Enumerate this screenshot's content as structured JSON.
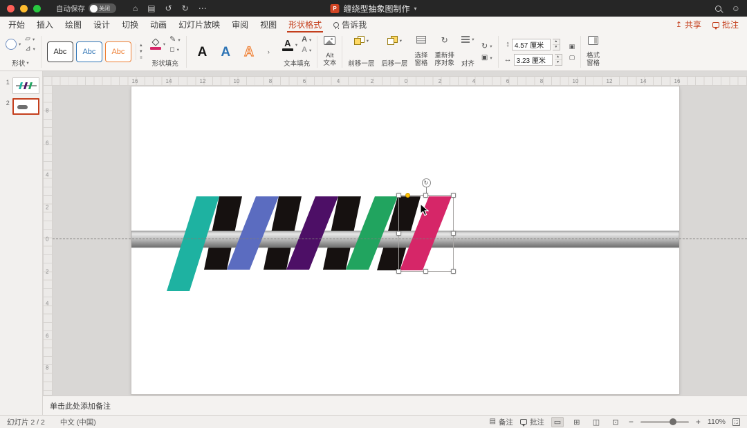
{
  "titlebar": {
    "autosave_label": "自动保存",
    "autosave_state": "关闭",
    "doc_title": "缠绕型抽象图制作"
  },
  "tabs": {
    "active": "形状格式",
    "items": [
      {
        "label": "开始"
      },
      {
        "label": "插入"
      },
      {
        "label": "绘图"
      },
      {
        "label": "设计"
      },
      {
        "label": "切换"
      },
      {
        "label": "动画"
      },
      {
        "label": "幻灯片放映"
      },
      {
        "label": "审阅"
      },
      {
        "label": "视图"
      },
      {
        "label": "形状格式"
      },
      {
        "label": "告诉我",
        "icon": "bulb"
      }
    ]
  },
  "quick_actions": {
    "share": "共享",
    "comments": "批注"
  },
  "ribbon": {
    "shapes_label": "形状",
    "style_samples": [
      "Abc",
      "Abc",
      "Abc"
    ],
    "wordart_samples": [
      "A",
      "A",
      "A"
    ],
    "shape_fill_label": "形状填充",
    "text_fill_label": "文本填充",
    "alt_text_label": [
      "Alt",
      "文本"
    ],
    "bring_forward_label": "前移一层",
    "send_backward_label": "后移一层",
    "selection_pane_label": [
      "选择",
      "窗格"
    ],
    "reorder_label": [
      "重新排",
      "序对象"
    ],
    "align_label": "对齐",
    "size_height_value": "4.57 厘米",
    "size_width_value": "3.23 厘米",
    "format_pane_label": [
      "格式",
      "窗格"
    ]
  },
  "slide_panel": {
    "slides": [
      {
        "number": "1",
        "selected": false
      },
      {
        "number": "2",
        "selected": true
      }
    ]
  },
  "rulers": {
    "horizontal": [
      "16",
      "14",
      "12",
      "10",
      "8",
      "6",
      "4",
      "2",
      "0",
      "2",
      "4",
      "6",
      "8",
      "10",
      "12",
      "14",
      "16"
    ],
    "vertical": [
      "8",
      "6",
      "4",
      "2",
      "0",
      "2",
      "4",
      "6",
      "8"
    ]
  },
  "canvas": {
    "notes_placeholder": "单击此处添加备注"
  },
  "statusbar": {
    "slide_indicator": "幻灯片 2 / 2",
    "language": "中文 (中国)",
    "notes_label": "备注",
    "comments_label": "批注",
    "zoom_level": "110%"
  },
  "colors": {
    "accent": "#c43e1c",
    "band_back": "#161110",
    "bands": [
      "#1eb2a1",
      "#5b6cc0",
      "#4d0f66",
      "#21a45f",
      "#d62668"
    ],
    "text_fill_bar": "#1a1a1a",
    "rod": [
      "#aeaeae",
      "#e8e8e8",
      "#c4c4c4",
      "#8f8f8f",
      "#6d6d6d"
    ]
  }
}
